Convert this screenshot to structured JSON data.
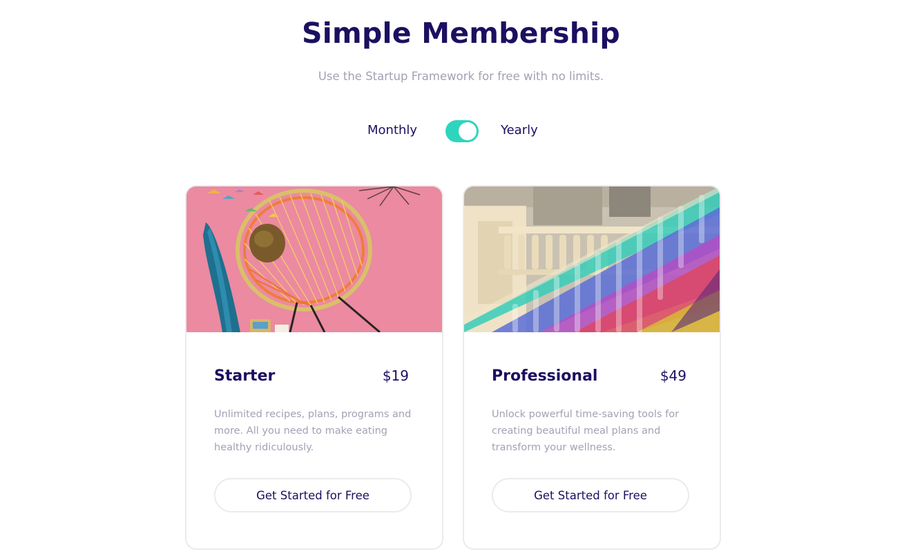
{
  "header": {
    "title": "Simple Membership",
    "subtitle": "Use the Startup Framework for free with no limits."
  },
  "billing_toggle": {
    "left_label": "Monthly",
    "right_label": "Yearly",
    "selected": "Yearly",
    "accent_color": "#2ed5bd"
  },
  "plans": [
    {
      "name": "Starter",
      "price": "$19",
      "description": "Unlimited recipes, plans, programs and more. All you need to make eating healthy ridiculously.",
      "button_label": "Get Started for Free",
      "image": "pink-chair-photo"
    },
    {
      "name": "Professional",
      "price": "$49",
      "description": "Unlock powerful time-saving tools for creating beautiful meal plans and transform your wellness.",
      "button_label": "Get Started for Free",
      "image": "rainbow-balustrade-photo"
    }
  ],
  "colors": {
    "heading": "#1b1060",
    "muted_text": "#a3a1b3",
    "border": "#ebeaed"
  }
}
